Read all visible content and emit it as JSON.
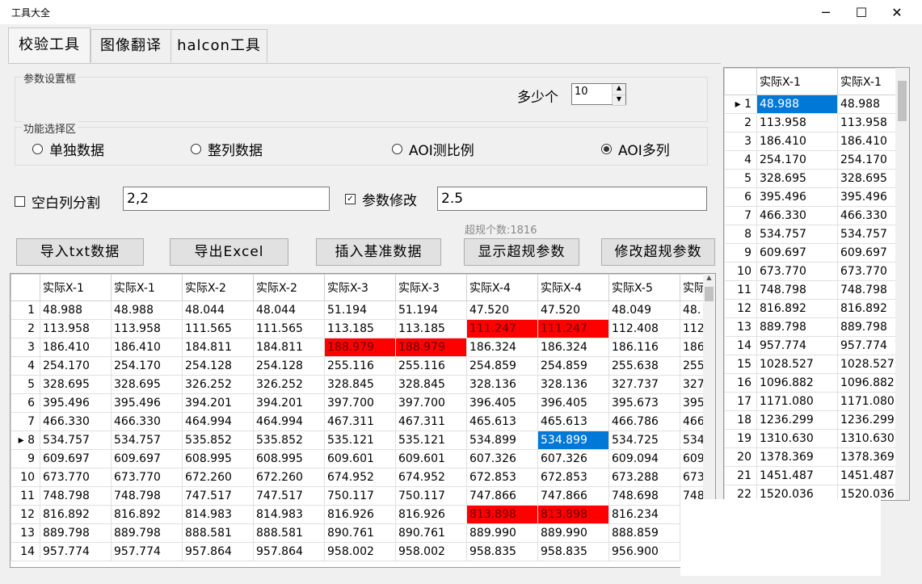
{
  "window": {
    "title": "工具大全",
    "minimize_icon": "minimize-icon",
    "maximize_icon": "maximize-icon",
    "close_icon": "close-icon",
    "controls": [
      "─",
      "☐",
      "✕"
    ]
  },
  "tabs": [
    {
      "label": "校验工具",
      "active": true
    },
    {
      "label": "图像翻译",
      "active": false
    },
    {
      "label": "halcon工具",
      "active": false
    }
  ],
  "params": {
    "legend": "参数设置框",
    "count_label": "多少个",
    "count_value": "10"
  },
  "functions": {
    "legend": "功能选择区",
    "options": [
      {
        "label": "单独数据",
        "checked": false
      },
      {
        "label": "整列数据",
        "checked": false
      },
      {
        "label": "AOI测比例",
        "checked": false
      },
      {
        "label": "AOI多列",
        "checked": true
      }
    ]
  },
  "options": {
    "split_label": "空白列分割",
    "split_checked": false,
    "split_value": "2,2",
    "modify_label": "参数修改",
    "modify_checked": true,
    "modify_value": "2.5"
  },
  "stats": {
    "overlimit_text": "超规个数:1816"
  },
  "buttons": {
    "import_txt": "导入txt数据",
    "export_excel": "导出Excel",
    "insert_base": "插入基准数据",
    "show_over": "显示超规参数",
    "modify_over": "修改超规参数"
  },
  "main_grid": {
    "columns": [
      "实际X-1",
      "实际X-1",
      "实际X-2",
      "实际X-2",
      "实际X-3",
      "实际X-3",
      "实际X-4",
      "实际X-4",
      "实际X-5",
      "实际"
    ],
    "rows": [
      {
        "n": "1",
        "cells": [
          "48.988",
          "48.988",
          "48.044",
          "48.044",
          "51.194",
          "51.194",
          "47.520",
          "47.520",
          "48.049",
          "48."
        ]
      },
      {
        "n": "2",
        "cells": [
          "113.958",
          "113.958",
          "111.565",
          "111.565",
          "113.185",
          "113.185",
          "111.247",
          "111.247",
          "112.408",
          "112"
        ],
        "red": [
          6,
          7
        ]
      },
      {
        "n": "3",
        "cells": [
          "186.410",
          "186.410",
          "184.811",
          "184.811",
          "188.979",
          "188.979",
          "186.324",
          "186.324",
          "186.116",
          "186"
        ],
        "red": [
          4,
          5
        ]
      },
      {
        "n": "4",
        "cells": [
          "254.170",
          "254.170",
          "254.128",
          "254.128",
          "255.116",
          "255.116",
          "254.859",
          "254.859",
          "255.638",
          "255"
        ]
      },
      {
        "n": "5",
        "cells": [
          "328.695",
          "328.695",
          "326.252",
          "326.252",
          "328.845",
          "328.845",
          "328.136",
          "328.136",
          "327.737",
          "327"
        ]
      },
      {
        "n": "6",
        "cells": [
          "395.496",
          "395.496",
          "394.201",
          "394.201",
          "397.700",
          "397.700",
          "396.405",
          "396.405",
          "395.673",
          "395"
        ]
      },
      {
        "n": "7",
        "cells": [
          "466.330",
          "466.330",
          "464.994",
          "464.994",
          "467.311",
          "467.311",
          "465.613",
          "465.613",
          "466.786",
          "466"
        ]
      },
      {
        "n": "8",
        "cells": [
          "534.757",
          "534.757",
          "535.852",
          "535.852",
          "535.121",
          "535.121",
          "534.899",
          "534.899",
          "534.725",
          "534"
        ],
        "sel": [
          7
        ],
        "current": true
      },
      {
        "n": "9",
        "cells": [
          "609.697",
          "609.697",
          "608.995",
          "608.995",
          "609.601",
          "609.601",
          "607.326",
          "607.326",
          "609.094",
          "609"
        ]
      },
      {
        "n": "10",
        "cells": [
          "673.770",
          "673.770",
          "672.260",
          "672.260",
          "674.952",
          "674.952",
          "672.853",
          "672.853",
          "673.288",
          "673"
        ]
      },
      {
        "n": "11",
        "cells": [
          "748.798",
          "748.798",
          "747.517",
          "747.517",
          "750.117",
          "750.117",
          "747.866",
          "747.866",
          "748.698",
          "748"
        ]
      },
      {
        "n": "12",
        "cells": [
          "816.892",
          "816.892",
          "814.983",
          "814.983",
          "816.926",
          "816.926",
          "813.898",
          "813.898",
          "816.234",
          ""
        ],
        "red": [
          6,
          7
        ]
      },
      {
        "n": "13",
        "cells": [
          "889.798",
          "889.798",
          "888.581",
          "888.581",
          "890.761",
          "890.761",
          "889.990",
          "889.990",
          "888.859",
          ""
        ]
      },
      {
        "n": "14",
        "cells": [
          "957.774",
          "957.774",
          "957.864",
          "957.864",
          "958.002",
          "958.002",
          "958.835",
          "958.835",
          "956.900",
          ""
        ]
      }
    ]
  },
  "side_grid": {
    "columns": [
      "实际X-1",
      "实际X-1"
    ],
    "rows": [
      {
        "n": "1",
        "cells": [
          "48.988",
          "48.988"
        ],
        "sel": [
          0
        ],
        "current": true
      },
      {
        "n": "2",
        "cells": [
          "113.958",
          "113.958"
        ]
      },
      {
        "n": "3",
        "cells": [
          "186.410",
          "186.410"
        ]
      },
      {
        "n": "4",
        "cells": [
          "254.170",
          "254.170"
        ]
      },
      {
        "n": "5",
        "cells": [
          "328.695",
          "328.695"
        ]
      },
      {
        "n": "6",
        "cells": [
          "395.496",
          "395.496"
        ]
      },
      {
        "n": "7",
        "cells": [
          "466.330",
          "466.330"
        ]
      },
      {
        "n": "8",
        "cells": [
          "534.757",
          "534.757"
        ]
      },
      {
        "n": "9",
        "cells": [
          "609.697",
          "609.697"
        ]
      },
      {
        "n": "10",
        "cells": [
          "673.770",
          "673.770"
        ]
      },
      {
        "n": "11",
        "cells": [
          "748.798",
          "748.798"
        ]
      },
      {
        "n": "12",
        "cells": [
          "816.892",
          "816.892"
        ]
      },
      {
        "n": "13",
        "cells": [
          "889.798",
          "889.798"
        ]
      },
      {
        "n": "14",
        "cells": [
          "957.774",
          "957.774"
        ]
      },
      {
        "n": "15",
        "cells": [
          "1028.527",
          "1028.527"
        ]
      },
      {
        "n": "16",
        "cells": [
          "1096.882",
          "1096.882"
        ]
      },
      {
        "n": "17",
        "cells": [
          "1171.080",
          "1171.080"
        ]
      },
      {
        "n": "18",
        "cells": [
          "1236.299",
          "1236.299"
        ]
      },
      {
        "n": "19",
        "cells": [
          "1310.630",
          "1310.630"
        ]
      },
      {
        "n": "20",
        "cells": [
          "1378.369",
          "1378.369"
        ]
      },
      {
        "n": "21",
        "cells": [
          "1451.487",
          "1451.487"
        ]
      },
      {
        "n": "22",
        "cells": [
          "1520.036",
          "1520.036"
        ]
      }
    ]
  },
  "colors": {
    "highlight_red": "#ff0000",
    "selection_blue": "#0078d7"
  }
}
